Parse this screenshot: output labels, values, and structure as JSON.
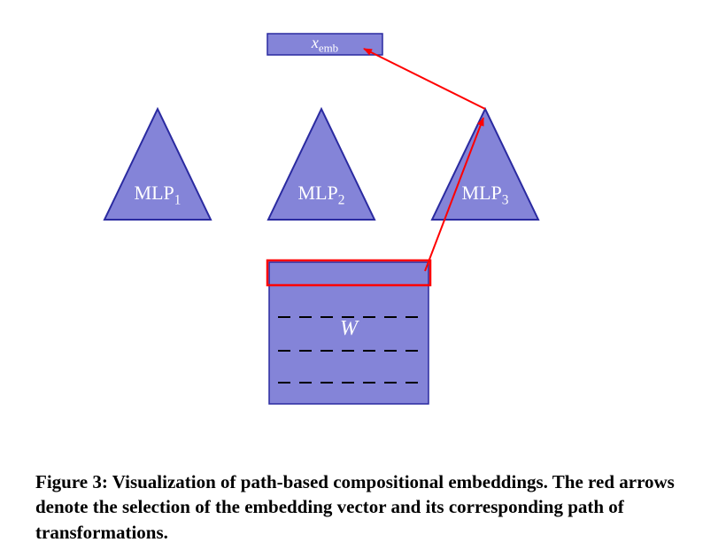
{
  "colors": {
    "fill": "#8484d8",
    "stroke": "#2a2aa0",
    "arrow": "#ff0000",
    "highlight_stroke": "#ff0000",
    "dash": "#000000"
  },
  "top_box": {
    "var": "x",
    "sub": "emb"
  },
  "mlps": [
    {
      "name": "MLP",
      "index": "1"
    },
    {
      "name": "MLP",
      "index": "2"
    },
    {
      "name": "MLP",
      "index": "3"
    }
  ],
  "matrix_label": "W",
  "caption_prefix": "Figure 3: ",
  "caption_body": "Visualization of path-based compositional embeddings. The red arrows denote the selection of the embedding vector and its corresponding path of transformations."
}
